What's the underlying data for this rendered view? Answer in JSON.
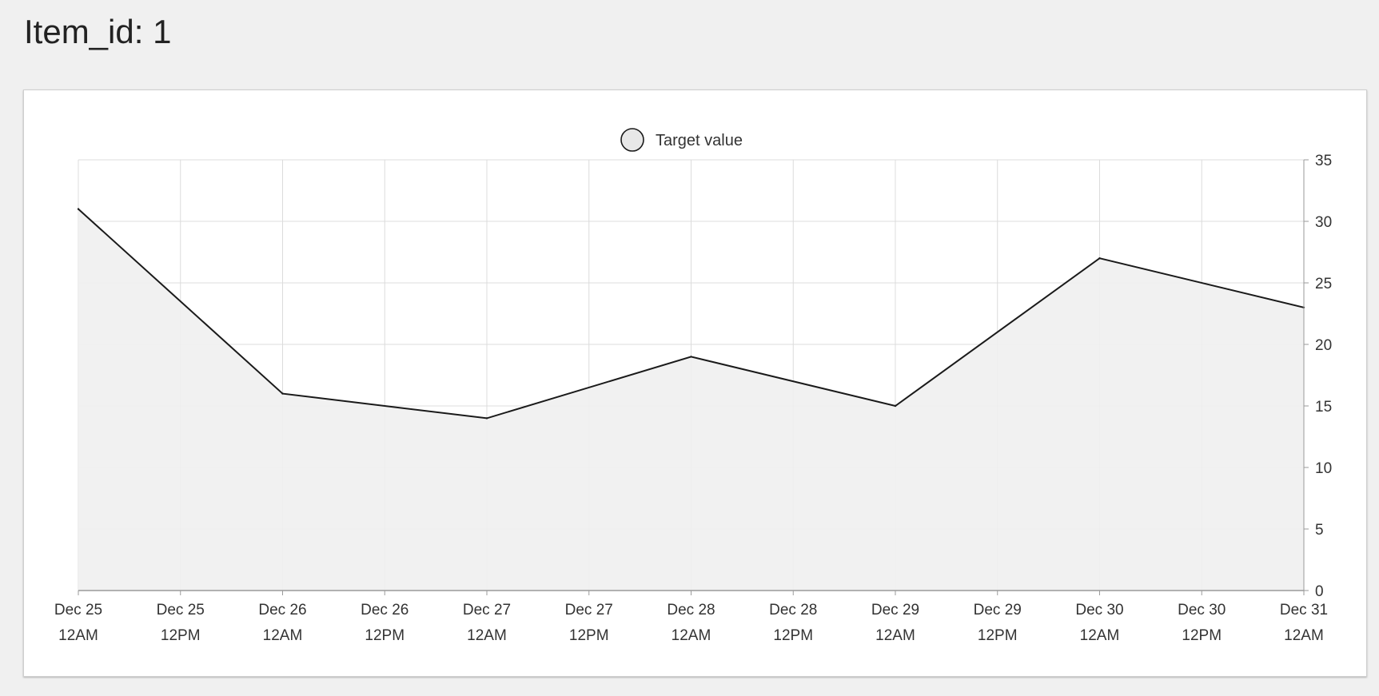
{
  "page": {
    "title": "Item_id: 1"
  },
  "chart_data": {
    "type": "area",
    "title": "",
    "xlabel": "",
    "ylabel": "",
    "legend": {
      "position": "top-center",
      "entries": [
        "Target value"
      ]
    },
    "grid": true,
    "y_axis_side": "right",
    "ylim": [
      0,
      35
    ],
    "yticks": [
      0,
      5,
      10,
      15,
      20,
      25,
      30,
      35
    ],
    "xlim": [
      "Dec 25 12AM",
      "Dec 31 12AM"
    ],
    "x_tick_labels": [
      [
        "Dec 25",
        "12AM"
      ],
      [
        "Dec 25",
        "12PM"
      ],
      [
        "Dec 26",
        "12AM"
      ],
      [
        "Dec 26",
        "12PM"
      ],
      [
        "Dec 27",
        "12AM"
      ],
      [
        "Dec 27",
        "12PM"
      ],
      [
        "Dec 28",
        "12AM"
      ],
      [
        "Dec 28",
        "12PM"
      ],
      [
        "Dec 29",
        "12AM"
      ],
      [
        "Dec 29",
        "12PM"
      ],
      [
        "Dec 30",
        "12AM"
      ],
      [
        "Dec 30",
        "12PM"
      ],
      [
        "Dec 31",
        "12AM"
      ]
    ],
    "series": [
      {
        "name": "Target value",
        "x": [
          "Dec 25 12AM",
          "Dec 26 12AM",
          "Dec 27 12AM",
          "Dec 28 12AM",
          "Dec 29 12AM",
          "Dec 30 12AM",
          "Dec 31 12AM"
        ],
        "values": [
          31,
          16,
          14,
          19,
          15,
          27,
          23
        ],
        "line_color": "#1a1a1a",
        "fill_color": "#efefef"
      }
    ],
    "colors": {
      "grid": "#dcdcdc",
      "axis": "#9a9a9a"
    }
  }
}
